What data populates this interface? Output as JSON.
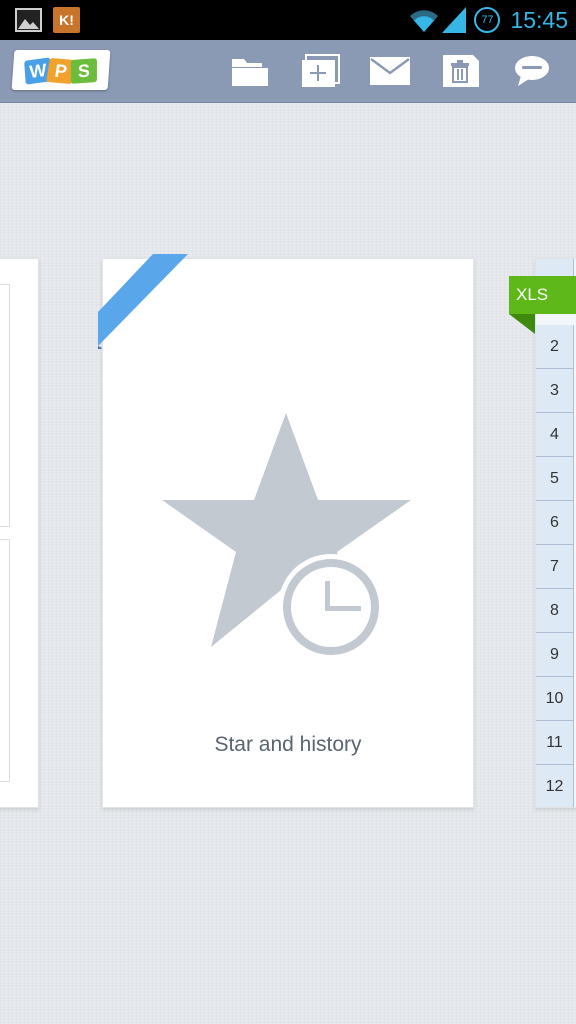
{
  "status_bar": {
    "time": "15:45",
    "battery_level": "77",
    "notification_app_label": "K!",
    "accent_color": "#35b6e5"
  },
  "toolbar": {
    "logo_letters": [
      "W",
      "P",
      "S"
    ],
    "logo_colors": [
      "#4aa0e6",
      "#f2a22c",
      "#6bbd3c"
    ],
    "buttons": [
      {
        "name": "open-folder",
        "icon": "folder-icon"
      },
      {
        "name": "new-document",
        "icon": "new-document-icon"
      },
      {
        "name": "mail",
        "icon": "mail-icon"
      },
      {
        "name": "delete",
        "icon": "trash-icon"
      },
      {
        "name": "feedback",
        "icon": "chat-bubble-icon"
      }
    ]
  },
  "cards": {
    "center": {
      "label": "Star and history",
      "icon": "star-clock-icon",
      "ribbon_color": "#5aa6ea"
    },
    "right": {
      "tag": "XLS",
      "tag_color": "#5fb81a",
      "row_numbers": [
        "2",
        "3",
        "4",
        "5",
        "6",
        "7",
        "8",
        "9",
        "10",
        "11",
        "12"
      ]
    }
  }
}
